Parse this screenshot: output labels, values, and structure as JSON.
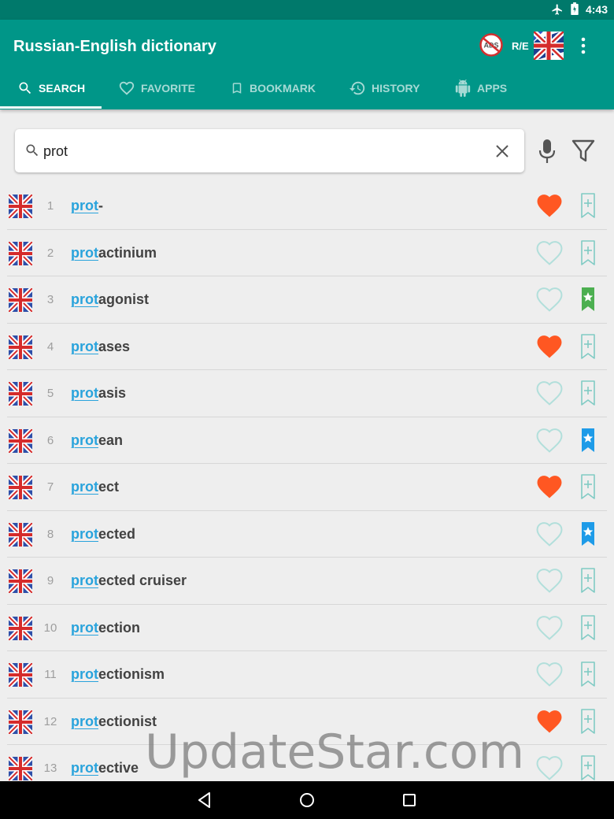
{
  "status_bar": {
    "time": "4:43",
    "icons": [
      "airplane-icon",
      "battery-icon"
    ]
  },
  "app": {
    "title": "Russian-English dictionary",
    "ads_label": "ADS",
    "lang_direction": "R/E",
    "accent": "#009688",
    "status_color": "#00796b"
  },
  "tabs": [
    {
      "label": "SEARCH",
      "icon": "search-icon",
      "active": true
    },
    {
      "label": "FAVORITE",
      "icon": "heart-icon",
      "active": false
    },
    {
      "label": "BOOKMARK",
      "icon": "bookmark-icon",
      "active": false
    },
    {
      "label": "HISTORY",
      "icon": "history-icon",
      "active": false
    },
    {
      "label": "APPS",
      "icon": "android-icon",
      "active": false
    }
  ],
  "search": {
    "value": "prot",
    "placeholder": ""
  },
  "results": [
    {
      "num": "1",
      "match": "prot",
      "rest": "-",
      "favorite": true,
      "bookmark": "none"
    },
    {
      "num": "2",
      "match": "prot",
      "rest": "actinium",
      "favorite": false,
      "bookmark": "none"
    },
    {
      "num": "3",
      "match": "prot",
      "rest": "agonist",
      "favorite": false,
      "bookmark": "green"
    },
    {
      "num": "4",
      "match": "prot",
      "rest": "ases",
      "favorite": true,
      "bookmark": "none"
    },
    {
      "num": "5",
      "match": "prot",
      "rest": "asis",
      "favorite": false,
      "bookmark": "none"
    },
    {
      "num": "6",
      "match": "prot",
      "rest": "ean",
      "favorite": false,
      "bookmark": "blue"
    },
    {
      "num": "7",
      "match": "prot",
      "rest": "ect",
      "favorite": true,
      "bookmark": "none"
    },
    {
      "num": "8",
      "match": "prot",
      "rest": "ected",
      "favorite": false,
      "bookmark": "blue"
    },
    {
      "num": "9",
      "match": "prot",
      "rest": "ected cruiser",
      "favorite": false,
      "bookmark": "none"
    },
    {
      "num": "10",
      "match": "prot",
      "rest": "ection",
      "favorite": false,
      "bookmark": "none"
    },
    {
      "num": "11",
      "match": "prot",
      "rest": "ectionism",
      "favorite": false,
      "bookmark": "none"
    },
    {
      "num": "12",
      "match": "prot",
      "rest": "ectionist",
      "favorite": true,
      "bookmark": "none"
    },
    {
      "num": "13",
      "match": "prot",
      "rest": "ective",
      "favorite": false,
      "bookmark": "none"
    }
  ],
  "colors": {
    "favorite_on": "#ff5722",
    "favorite_off": "#b2dfdb",
    "bookmark_off": "#80cbc4",
    "bookmark_green": "#4caf50",
    "bookmark_blue": "#1e9be8",
    "highlight": "#29a3dc"
  },
  "watermark": "UpdateStar.com",
  "nav": [
    "back-icon",
    "home-icon",
    "recents-icon"
  ]
}
